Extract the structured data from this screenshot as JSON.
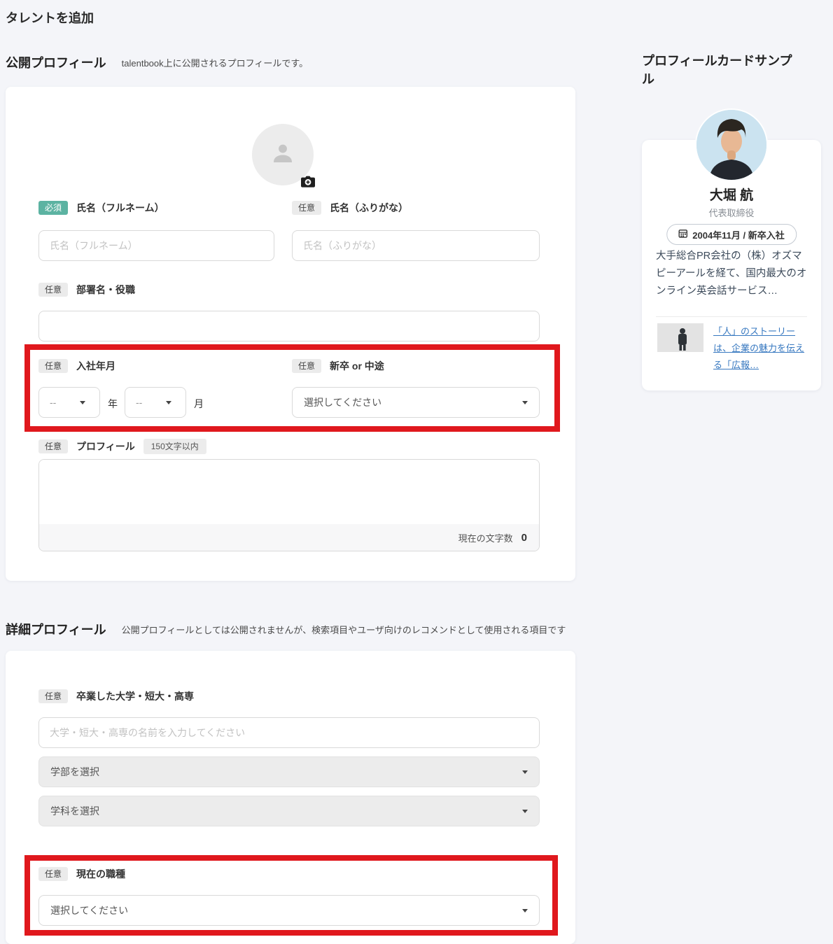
{
  "page_title": "タレントを追加",
  "badges": {
    "required": "必須",
    "optional": "任意"
  },
  "public_profile": {
    "heading": "公開プロフィール",
    "subtitle": "talentbook上に公開されるプロフィールです。",
    "full_name": {
      "label": "氏名（フルネーム）",
      "placeholder": "氏名（フルネーム）"
    },
    "furigana": {
      "label": "氏名（ふりがな）",
      "placeholder": "氏名（ふりがな）"
    },
    "department_title": {
      "label": "部署名・役職"
    },
    "join_date": {
      "label": "入社年月",
      "year_value": "--",
      "year_unit": "年",
      "month_value": "--",
      "month_unit": "月"
    },
    "hire_type": {
      "label": "新卒 or 中途",
      "value": "選択してください"
    },
    "profile": {
      "label": "プロフィール",
      "limit_badge": "150文字以内",
      "counter_label": "現在の文字数",
      "counter_value": "0"
    }
  },
  "detail_profile": {
    "heading": "詳細プロフィール",
    "subtitle": "公開プロフィールとしては公開されませんが、検索項目やユーザ向けのレコメンドとして使用される項目です",
    "university": {
      "label": "卒業した大学・短大・高専",
      "placeholder": "大学・短大・高専の名前を入力してください"
    },
    "faculty_select": {
      "value": "学部を選択"
    },
    "department_select": {
      "value": "学科を選択"
    },
    "occupation": {
      "label": "現在の職種",
      "value": "選択してください"
    }
  },
  "profile_card_sample": {
    "heading": "プロフィールカードサンプル",
    "name": "大堀 航",
    "job_title": "代表取締役",
    "joined_badge": "2004年11月 / 新卒入社",
    "bio": "大手総合PR会社の（株）オズマピーアールを経て、国内最大のオンライン英会話サービス…",
    "story_link": "「人」のストーリーは、企業の魅力を伝える「広報…"
  },
  "colors": {
    "required_badge": "#5cb3a2",
    "optional_badge": "#ebebeb",
    "annotation_red": "#e0181d",
    "link_blue": "#3778c0",
    "page_background": "#f4f5f9"
  }
}
